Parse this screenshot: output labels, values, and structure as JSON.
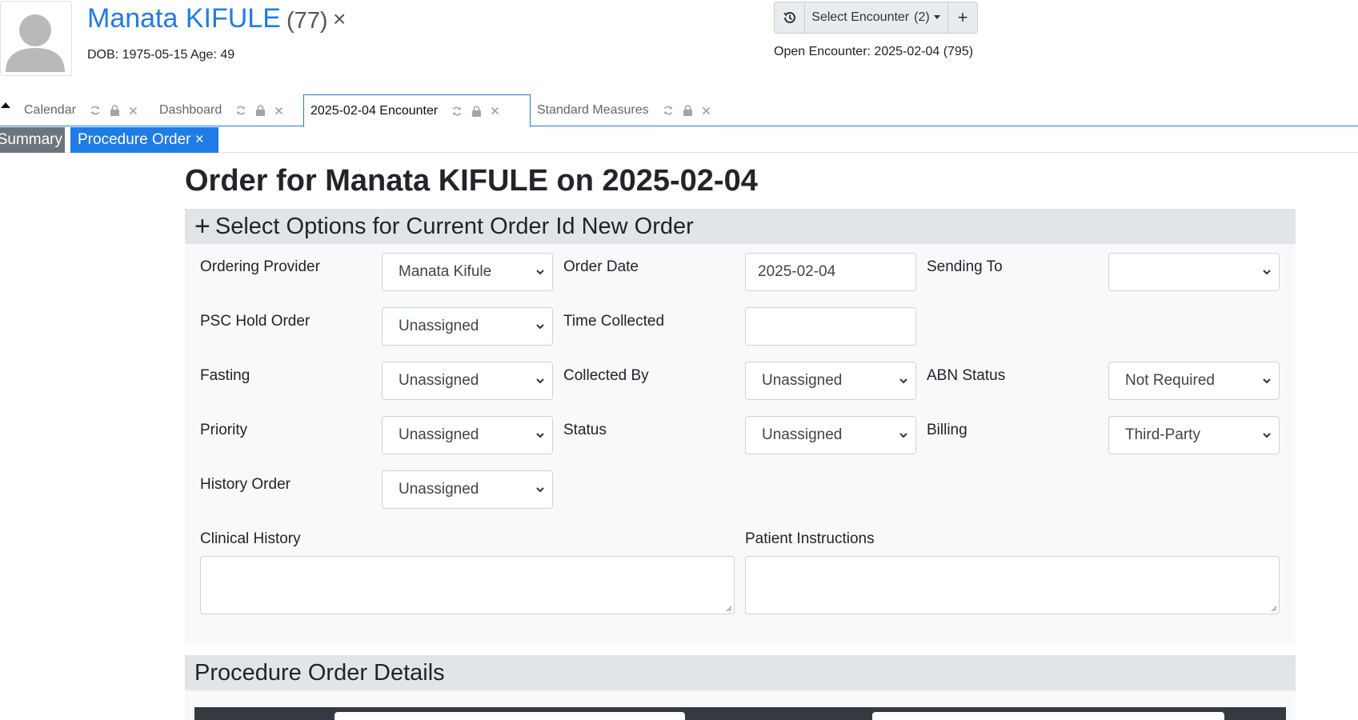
{
  "header": {
    "patient_name": "Manata KIFULE",
    "patient_id": "(77)",
    "close_glyph": "×",
    "dob_line": "DOB: 1975-05-15 Age: 49",
    "encounter": {
      "history_icon": "history-icon",
      "select_label": "Select Encounter",
      "select_count": "(2)",
      "add_glyph": "+",
      "open_encounter": "Open Encounter: 2025-02-04 (795)"
    }
  },
  "tabs": [
    {
      "label": "Calendar",
      "active": false
    },
    {
      "label": "Dashboard",
      "active": false
    },
    {
      "label": "2025-02-04 Encounter",
      "active": true
    },
    {
      "label": "Standard Measures",
      "active": false
    }
  ],
  "subtabs": [
    {
      "label": "Summary",
      "active": false
    },
    {
      "label": "Procedure Order ×",
      "active": true
    }
  ],
  "page_title": "Order for Manata KIFULE on 2025-02-04",
  "options_panel": {
    "heading_icon": "+",
    "heading": "Select Options for Current Order Id New Order",
    "fields": {
      "ordering_provider": {
        "label": "Ordering Provider",
        "value": "Manata Kifule"
      },
      "order_date": {
        "label": "Order Date",
        "value": "2025-02-04"
      },
      "sending_to": {
        "label": "Sending To",
        "value": ""
      },
      "psc_hold_order": {
        "label": "PSC Hold Order",
        "value": "Unassigned"
      },
      "time_collected": {
        "label": "Time Collected",
        "value": ""
      },
      "fasting": {
        "label": "Fasting",
        "value": "Unassigned"
      },
      "collected_by": {
        "label": "Collected By",
        "value": "Unassigned"
      },
      "abn_status": {
        "label": "ABN Status",
        "value": "Not Required"
      },
      "priority": {
        "label": "Priority",
        "value": "Unassigned"
      },
      "status": {
        "label": "Status",
        "value": "Unassigned"
      },
      "billing": {
        "label": "Billing",
        "value": "Third-Party"
      },
      "history_order": {
        "label": "History Order",
        "value": "Unassigned"
      },
      "clinical_history": {
        "label": "Clinical History",
        "value": ""
      },
      "patient_instructions": {
        "label": "Patient Instructions",
        "value": ""
      }
    }
  },
  "details_panel": {
    "heading": "Procedure Order Details"
  },
  "colors": {
    "link_blue": "#1f7ce6",
    "subtab_summary_bg": "#6c757d",
    "subtab_active_bg": "#1f7ce6",
    "panel_bg": "#f8f9fa",
    "panel_head_bg": "#e1e4e8"
  }
}
